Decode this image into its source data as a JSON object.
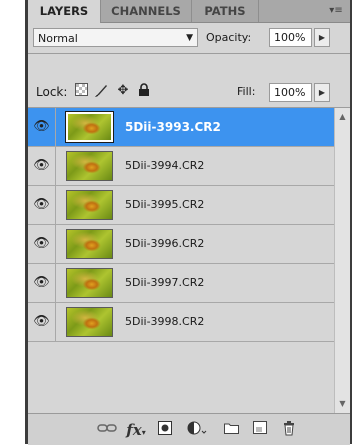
{
  "tabs": [
    {
      "label": "LAYERS",
      "active": true
    },
    {
      "label": "CHANNELS",
      "active": false
    },
    {
      "label": "PATHS",
      "active": false
    }
  ],
  "menu_icon": "panel-menu-icon",
  "blend": {
    "mode": "Normal",
    "opacity_label": "Opacity:",
    "opacity_value": "100%"
  },
  "lock": {
    "label": "Lock:",
    "fill_label": "Fill:",
    "fill_value": "100%",
    "icons": [
      "lock-transparent-icon",
      "lock-image-icon",
      "lock-position-icon",
      "lock-all-icon"
    ]
  },
  "layers": [
    {
      "name": "5Dii-3993.CR2",
      "selected": true
    },
    {
      "name": "5Dii-3994.CR2",
      "selected": false
    },
    {
      "name": "5Dii-3995.CR2",
      "selected": false
    },
    {
      "name": "5Dii-3996.CR2",
      "selected": false
    },
    {
      "name": "5Dii-3997.CR2",
      "selected": false
    },
    {
      "name": "5Dii-3998.CR2",
      "selected": false
    }
  ],
  "toolbar_icons": [
    "link-layers-icon",
    "layer-style-icon",
    "layer-mask-icon",
    "adjustment-layer-icon",
    "new-group-icon",
    "new-layer-icon",
    "delete-layer-icon"
  ],
  "colors": {
    "selection": "#3d93ef",
    "panel": "#d6d6d6",
    "tabbar": "#a8a8a8"
  }
}
